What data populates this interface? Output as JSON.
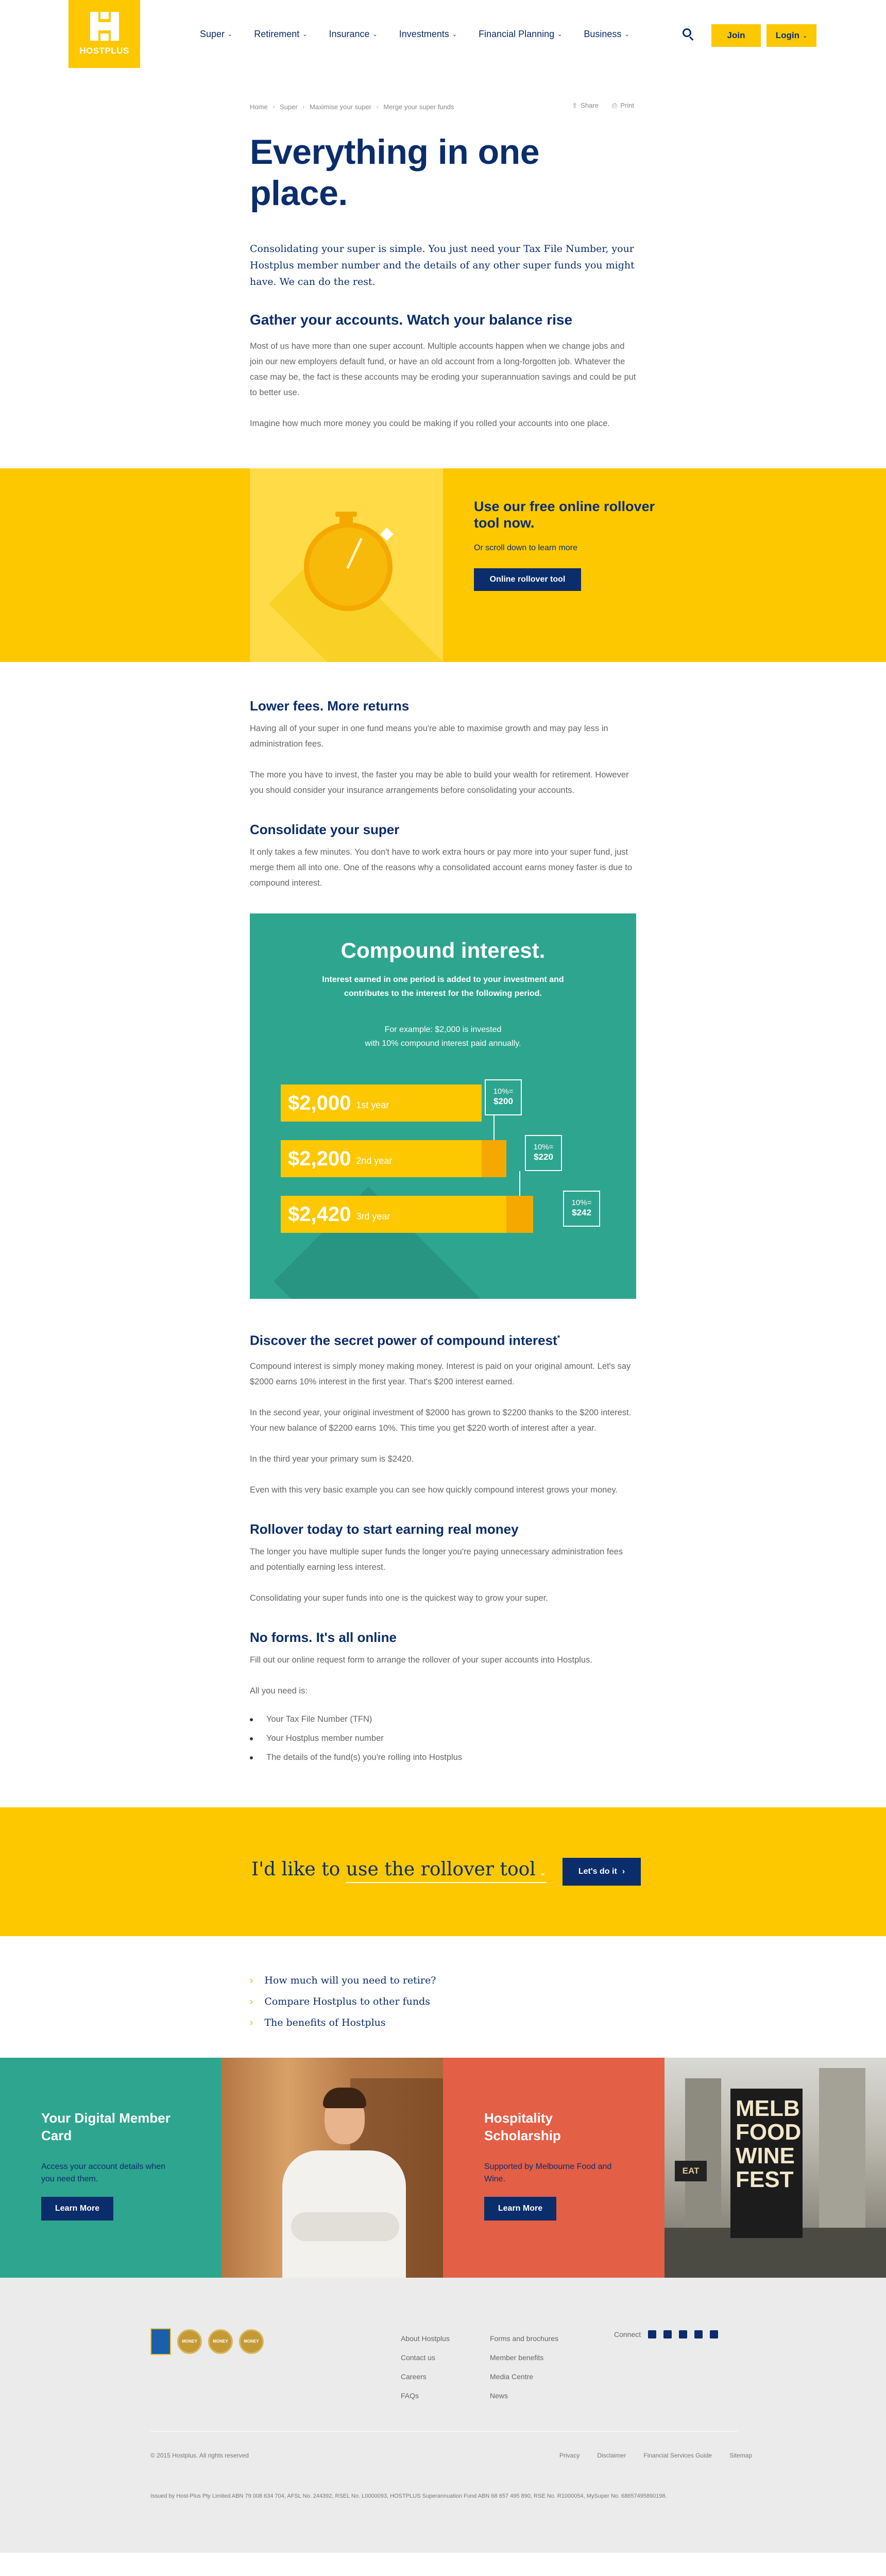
{
  "header": {
    "logo_text": "HOSTPLUS",
    "nav": [
      "Super",
      "Retirement",
      "Insurance",
      "Investments",
      "Financial Planning",
      "Business"
    ],
    "join_label": "Join",
    "login_label": "Login"
  },
  "breadcrumbs": [
    "Home",
    "Super",
    "Maximise your super",
    "Merge your super funds"
  ],
  "share_label": "Share",
  "print_label": "Print",
  "title": "Everything in one place.",
  "intro": "Consolidating your super is simple. You just need your Tax File Number, your Hostplus member number and the details of any other super funds you might have. We can do the rest.",
  "section1": {
    "heading": "Gather your accounts. Watch your balance rise",
    "p1": "Most of us have more than one super account. Multiple accounts happen when we change jobs and join our new employers default fund, or have an old account from a long-forgotten job. Whatever the case may be, the fact is these accounts may be eroding your superannuation savings and could be put to better use.",
    "p2": "Imagine how much more money you could be making if you rolled your accounts into one place."
  },
  "tool_banner": {
    "heading": "Use our free online rollover tool now.",
    "sub": "Or scroll down to learn more",
    "button": "Online rollover tool"
  },
  "section2": {
    "heading": "Lower fees. More returns",
    "p1": "Having all of your super in one fund means you're able to maximise growth and may pay less in administration fees.",
    "p2": "The more you have to invest, the faster you may be able to build your wealth for retirement. However you should consider your insurance arrangements before consolidating your accounts."
  },
  "section3": {
    "heading": "Consolidate your super",
    "p1": "It only takes a few minutes. You don't have to work extra hours or pay more into your super fund, just merge them all into one. One of the reasons why a consolidated account earns money faster is due to compound interest."
  },
  "infographic": {
    "title": "Compound interest.",
    "subtitle": "Interest earned in one period is added to your investment and contributes to the interest for the following period.",
    "example_line1": "For example: $2,000 is invested",
    "example_line2": "with 10% compound interest paid annually.",
    "rows": [
      {
        "amount": "$2,000",
        "year": "1st year",
        "pct": "10%=",
        "interest": "$200"
      },
      {
        "amount": "$2,200",
        "year": "2nd year",
        "pct": "10%=",
        "interest": "$220"
      },
      {
        "amount": "$2,420",
        "year": "3rd year",
        "pct": "10%=",
        "interest": "$242"
      }
    ]
  },
  "section4": {
    "heading": "Discover the secret power of compound interest",
    "heading_mark": "*",
    "p1": "Compound interest is simply money making money. Interest is paid on your original amount. Let's say $2000 earns 10% interest in the first year. That's $200 interest earned.",
    "p2": "In the second year, your original investment of $2000 has grown to $2200 thanks to the $200 interest. Your new balance of $2200 earns 10%. This time you get $220 worth of interest after a year.",
    "p3": "In the third year your primary sum is $2420.",
    "p4": "Even with this very basic example you can see how quickly compound interest grows your money."
  },
  "section5": {
    "heading": "Rollover today to start earning real money",
    "p1": "The longer you have multiple super funds the longer you're paying unnecessary administration fees and potentially earning less interest.",
    "p2": "Consolidating your super funds into one is the quickest way to grow your super."
  },
  "section6": {
    "heading": "No forms. It's all online",
    "p1": "Fill out our online request form to arrange the rollover of your super accounts into Hostplus.",
    "p2": "All you need is:",
    "bullets": [
      "Your Tax File Number (TFN)",
      "Your Hostplus member number",
      "The details of the fund(s) you're rolling into Hostplus"
    ]
  },
  "cta": {
    "prefix": "I'd like to",
    "selected": "use the rollover tool",
    "button": "Let's do it"
  },
  "related_links": [
    "How much will you need to retire?",
    "Compare Hostplus to other funds",
    "The benefits of Hostplus"
  ],
  "promos": {
    "card1_title": "Your Digital Member Card",
    "card1_desc": "Access your account details when you need them.",
    "card1_button": "Learn More",
    "card2_title": "Hospitality Scholarship",
    "card2_desc": "Supported by Melbourne Food and Wine.",
    "card2_button": "Learn More",
    "fest_sign": "MELB FOOD WINE FEST",
    "fest_eat": "EAT"
  },
  "footer": {
    "col1": [
      "About Hostplus",
      "Contact us",
      "Careers",
      "FAQs"
    ],
    "col2": [
      "Forms and brochures",
      "Member benefits",
      "Media Centre",
      "News"
    ],
    "connect_label": "Connect",
    "badge_text": "MONEY",
    "copyright": "© 2015 Hostplus. All rights reserved",
    "legal": [
      "Privacy",
      "Disclaimer",
      "Financial Services Guide",
      "Sitemap"
    ],
    "fine_print": "Issued by Host-Plus Pty Limited ABN 79 008 634 704, AFSL No. 244392, RSEL No. L0000093, HOSTPLUS Superannuation Fund ABN 68 657 495 890, RSE No. R1000054, MySuper No. 68657495890198."
  }
}
